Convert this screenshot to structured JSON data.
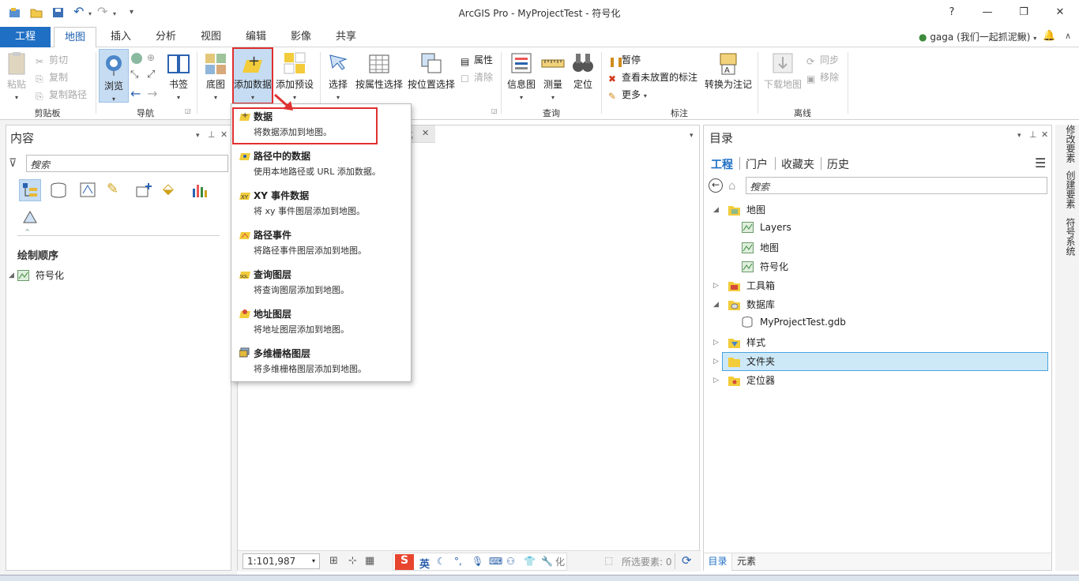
{
  "window": {
    "title": "ArcGIS Pro - MyProjectTest - 符号化",
    "help": "?",
    "minimize": "—",
    "restore": "❐",
    "close": "✕"
  },
  "qat": {
    "undo": "↶",
    "redo": "↷"
  },
  "tabs": [
    {
      "label": "工程"
    },
    {
      "label": "地图"
    },
    {
      "label": "插入"
    },
    {
      "label": "分析"
    },
    {
      "label": "视图"
    },
    {
      "label": "编辑"
    },
    {
      "label": "影像"
    },
    {
      "label": "共享"
    }
  ],
  "user": {
    "name": "gaga (我们一起抓泥鳅)"
  },
  "ribbon": {
    "clipboard": {
      "label": "剪贴板",
      "paste": "粘贴",
      "cut": "剪切",
      "copy": "复制",
      "copy_path": "复制路径"
    },
    "navigate": {
      "label": "导航",
      "explore": "浏览",
      "bookmarks": "书签"
    },
    "layer": {
      "basemap": "底图",
      "add_data": "添加数据",
      "add_preset": "添加预设"
    },
    "selection": {
      "select": "选择",
      "by_attr": "按属性选择",
      "by_loc": "按位置选择",
      "attributes": "属性",
      "clear": "清除"
    },
    "inquiry": {
      "label": "查询",
      "infographic": "信息图",
      "measure": "测量",
      "locate": "定位"
    },
    "labeling": {
      "label": "标注",
      "pause": "暂停",
      "view_unplaced": "查看未放置的标注",
      "more": "更多",
      "convert": "转换为注记"
    },
    "offline": {
      "label": "离线",
      "download": "下载地图",
      "sync": "同步",
      "remove": "移除"
    }
  },
  "contents": {
    "title": "内容",
    "search_placeholder": "搜索",
    "draw_order": "绘制顺序",
    "map_name": "符号化"
  },
  "map_tab": {
    "label": "化"
  },
  "dropdown": [
    {
      "title": "数据",
      "desc": "将数据添加到地图。"
    },
    {
      "title": "路径中的数据",
      "desc": "使用本地路径或 URL 添加数据。"
    },
    {
      "title": "XY 事件数据",
      "desc": "将 xy 事件图层添加到地图。"
    },
    {
      "title": "路径事件",
      "desc": "将路径事件图层添加到地图。"
    },
    {
      "title": "查询图层",
      "desc": "将查询图层添加到地图。"
    },
    {
      "title": "地址图层",
      "desc": "将地址图层添加到地图。"
    },
    {
      "title": "多维栅格图层",
      "desc": "将多维栅格图层添加到地图。"
    }
  ],
  "catalog": {
    "title": "目录",
    "tabs": [
      "工程",
      "门户",
      "收藏夹",
      "历史"
    ],
    "search_placeholder": "搜索",
    "tree": {
      "maps": "地图",
      "layers": "Layers",
      "map": "地图",
      "symbology": "符号化",
      "toolboxes": "工具箱",
      "databases": "数据库",
      "gdb": "MyProjectTest.gdb",
      "styles": "样式",
      "folders": "文件夹",
      "locators": "定位器"
    },
    "bottom_tabs": [
      "目录",
      "元素"
    ]
  },
  "side_tabs": [
    "修改要素",
    "创建要素",
    "符号系统"
  ],
  "status": {
    "scale": "1:101,987",
    "selected": "所选要素: 0",
    "ime_lang": "英"
  },
  "colors": {
    "accent": "#1f6fc4",
    "highlight": "#e03030",
    "selected_row": "#cde8f7"
  }
}
